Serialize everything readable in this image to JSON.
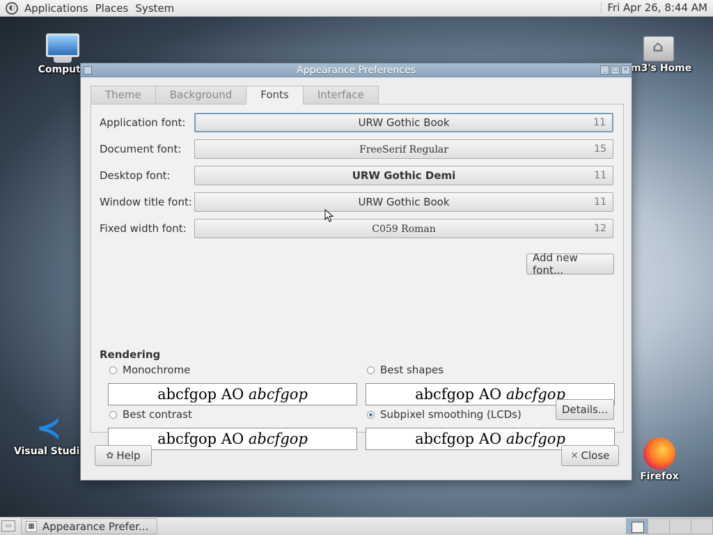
{
  "top_panel": {
    "menus": [
      "Applications",
      "Places",
      "System"
    ],
    "clock": "Fri Apr 26,  8:44 AM"
  },
  "desktop_icons": {
    "computer": "Compute",
    "home": "m3's Home",
    "vscode": "Visual Studio",
    "firefox": "Firefox"
  },
  "dialog": {
    "title": "Appearance Preferences",
    "tabs": [
      "Theme",
      "Background",
      "Fonts",
      "Interface"
    ],
    "active_tab": "Fonts",
    "fonts": [
      {
        "label": "Application font:",
        "name": "URW Gothic Book",
        "size": "11"
      },
      {
        "label": "Document font:",
        "name": "FreeSerif Regular",
        "size": "15"
      },
      {
        "label": "Desktop font:",
        "name": "URW Gothic Demi",
        "size": "11"
      },
      {
        "label": "Window title font:",
        "name": "URW Gothic Book",
        "size": "11"
      },
      {
        "label": "Fixed width font:",
        "name": "C059 Roman",
        "size": "12"
      }
    ],
    "add_font_button": "Add new font...",
    "rendering": {
      "title": "Rendering",
      "options": [
        {
          "label": "Monochrome",
          "checked": false
        },
        {
          "label": "Best shapes",
          "checked": false
        },
        {
          "label": "Best contrast",
          "checked": false
        },
        {
          "label": "Subpixel smoothing (LCDs)",
          "checked": true
        }
      ],
      "sample_regular": "abcfgop AO ",
      "sample_italic": "abcfgop"
    },
    "details_button": "Details...",
    "help_button": "Help",
    "close_button": "Close"
  },
  "taskbar": {
    "window_button": "Appearance Prefer..."
  },
  "colors": {
    "title_bar": "#8ea6be",
    "radio_checked": "#4f79b3"
  }
}
